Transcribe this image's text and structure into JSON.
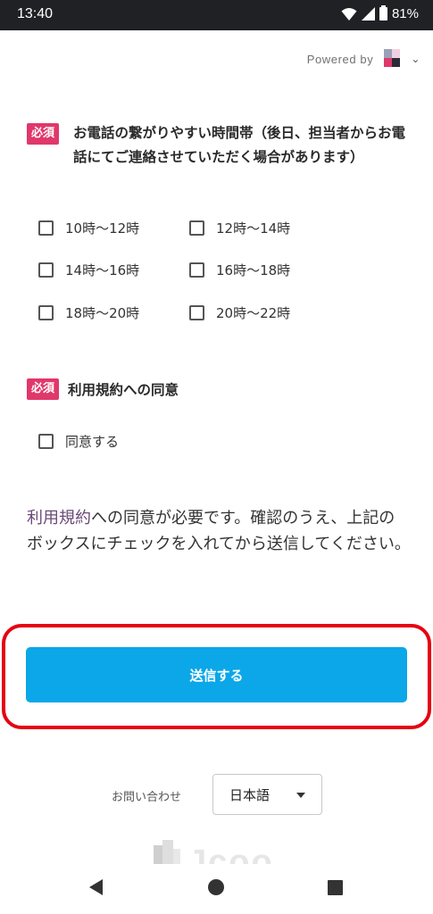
{
  "status_bar": {
    "time": "13:40",
    "battery": "81%"
  },
  "header": {
    "powered_by": "Powered by",
    "logo_icon": "colorful-squares-logo",
    "menu_icon": "chevron-down-icon"
  },
  "question1": {
    "required_label": "必須",
    "text": "お電話の繋がりやすい時間帯（後日、担当者からお電話にてご連絡させていただく場合があります）",
    "options": [
      "10時〜12時",
      "12時〜14時",
      "14時〜16時",
      "16時〜18時",
      "18時〜20時",
      "20時〜22時"
    ]
  },
  "question2": {
    "required_label": "必須",
    "text": "利用規約への同意",
    "option": "同意する"
  },
  "notice": {
    "link_text": "利用規約",
    "text": "への同意が必要です。確認のうえ、上記のボックスにチェックを入れてから送信してください。"
  },
  "submit": {
    "label": "送信する"
  },
  "footer": {
    "contact_label": "お問い合わせ",
    "language": "日本語",
    "language_options": [
      "日本語"
    ],
    "brand_text": "Jcoo"
  },
  "colors": {
    "required_badge": "#e0386b",
    "submit_button": "#0ba7e8",
    "highlight_border": "#e60012",
    "link": "#6b4a78"
  }
}
